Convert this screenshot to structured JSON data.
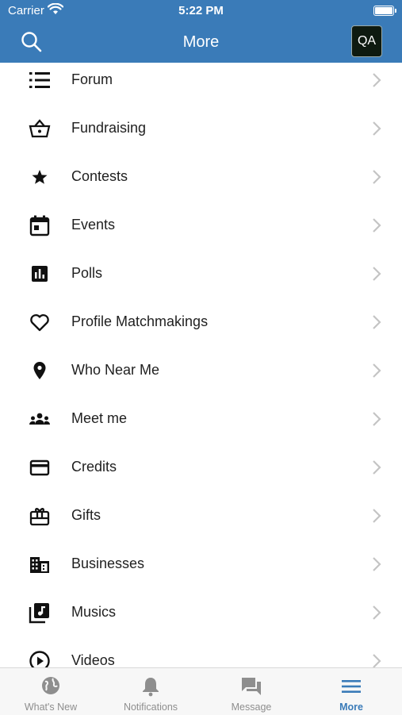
{
  "status_bar": {
    "carrier": "Carrier",
    "time": "5:22 PM"
  },
  "header": {
    "title": "More",
    "avatar_initials": "QA"
  },
  "menu": {
    "items": [
      {
        "label": "Forum",
        "icon": "list-icon"
      },
      {
        "label": "Fundraising",
        "icon": "basket-icon"
      },
      {
        "label": "Contests",
        "icon": "star-icon"
      },
      {
        "label": "Events",
        "icon": "calendar-icon"
      },
      {
        "label": "Polls",
        "icon": "poll-icon"
      },
      {
        "label": "Profile Matchmakings",
        "icon": "heart-icon"
      },
      {
        "label": "Who Near Me",
        "icon": "location-pin-icon"
      },
      {
        "label": "Meet me",
        "icon": "group-icon"
      },
      {
        "label": "Credits",
        "icon": "credit-card-icon"
      },
      {
        "label": "Gifts",
        "icon": "gift-card-icon"
      },
      {
        "label": "Businesses",
        "icon": "building-icon"
      },
      {
        "label": "Musics",
        "icon": "music-library-icon"
      },
      {
        "label": "Videos",
        "icon": "play-circle-icon"
      }
    ]
  },
  "tabbar": {
    "tabs": [
      {
        "label": "What's New",
        "icon": "globe-icon",
        "active": false
      },
      {
        "label": "Notifications",
        "icon": "bell-icon",
        "active": false
      },
      {
        "label": "Message",
        "icon": "chat-icon",
        "active": false
      },
      {
        "label": "More",
        "icon": "hamburger-icon",
        "active": true
      }
    ]
  },
  "colors": {
    "header_bg": "#3a7bb8",
    "active_tab": "#3a7bb8",
    "inactive_tab": "#8e8e8e",
    "chevron": "#c4c4c4"
  }
}
